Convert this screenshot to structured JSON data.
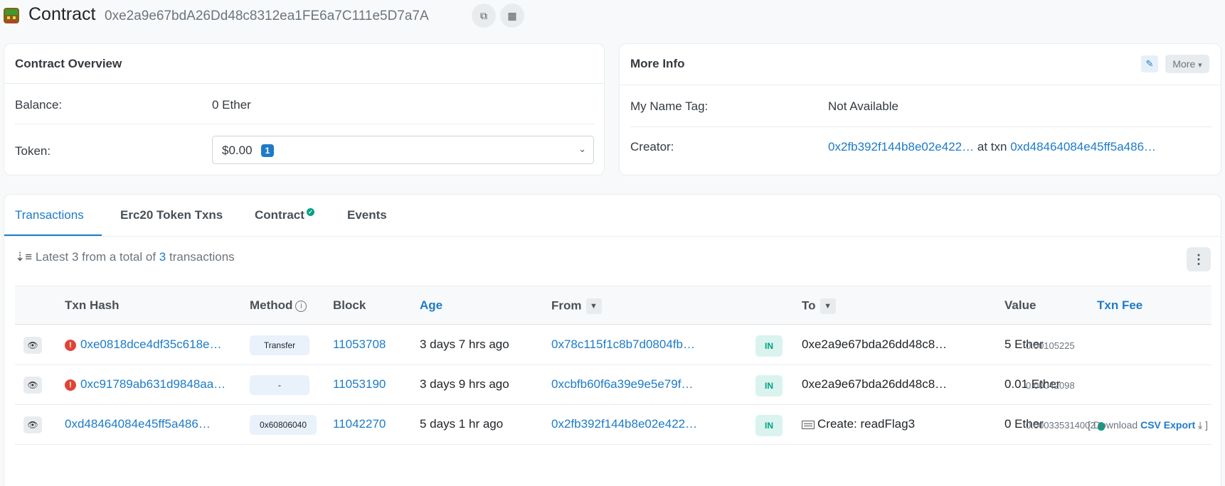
{
  "header": {
    "title": "Contract",
    "address": "0xe2a9e67bdA26Dd48c8312ea1FE6a7C111e5D7a7A",
    "copy_icon": "copy-icon",
    "qr_icon": "qr-code-icon"
  },
  "overview": {
    "title": "Contract Overview",
    "balance_label": "Balance:",
    "balance_value": "0 Ether",
    "token_label": "Token:",
    "token_value": "$0.00",
    "token_count": "1"
  },
  "more_info": {
    "title": "More Info",
    "more_label": "More",
    "name_tag_label": "My Name Tag:",
    "name_tag_value": "Not Available",
    "creator_label": "Creator:",
    "creator_address": "0x2fb392f144b8e02e422…",
    "creator_at": "at txn",
    "creator_txn": "0xd48464084e45ff5a486…"
  },
  "tabs": [
    {
      "label": "Transactions",
      "active": true
    },
    {
      "label": "Erc20 Token Txns",
      "active": false
    },
    {
      "label": "Contract",
      "active": false
    },
    {
      "label": "Events",
      "active": false
    }
  ],
  "summary": {
    "prefix": "Latest 3 from a total of",
    "count": "3",
    "suffix": "transactions"
  },
  "table": {
    "headers": {
      "hash": "Txn Hash",
      "method": "Method",
      "block": "Block",
      "age": "Age",
      "from": "From",
      "to": "To",
      "value": "Value",
      "fee": "Txn Fee"
    },
    "rows": [
      {
        "error": true,
        "hash": "0xe0818dce4df35c618e…",
        "method": "Transfer",
        "block": "11053708",
        "age": "3 days 7 hrs ago",
        "from": "0x78c115f1c8b7d0804fb…",
        "direction": "IN",
        "to": "0xe2a9e67bda26dd48c8…",
        "value": "5 Ether",
        "fee": "0.00105225"
      },
      {
        "error": true,
        "hash": "0xc91789ab631d9848aa…",
        "method": "-",
        "block": "11053190",
        "age": "3 days 9 hrs ago",
        "from": "0xcbfb60f6a39e9e5e79f…",
        "direction": "IN",
        "to": "0xe2a9e67bda26dd48c8…",
        "value": "0.01 Ether",
        "fee": "0.00042098"
      },
      {
        "error": false,
        "hash": "0xd48464084e45ff5a486…",
        "method": "0x60806040",
        "block": "11042270",
        "age": "5 days 1 hr ago",
        "from": "0x2fb392f144b8e02e422…",
        "direction": "IN",
        "to": "Create: readFlag3",
        "value": "0 Ether",
        "fee": "0.000335314002"
      }
    ]
  },
  "csv": {
    "prefix": "[ Download",
    "link": "CSV Export",
    "suffix": "]"
  },
  "colors": {
    "accent": "#1e7bc8",
    "in_badge": "#00a186",
    "error": "#de4437"
  }
}
